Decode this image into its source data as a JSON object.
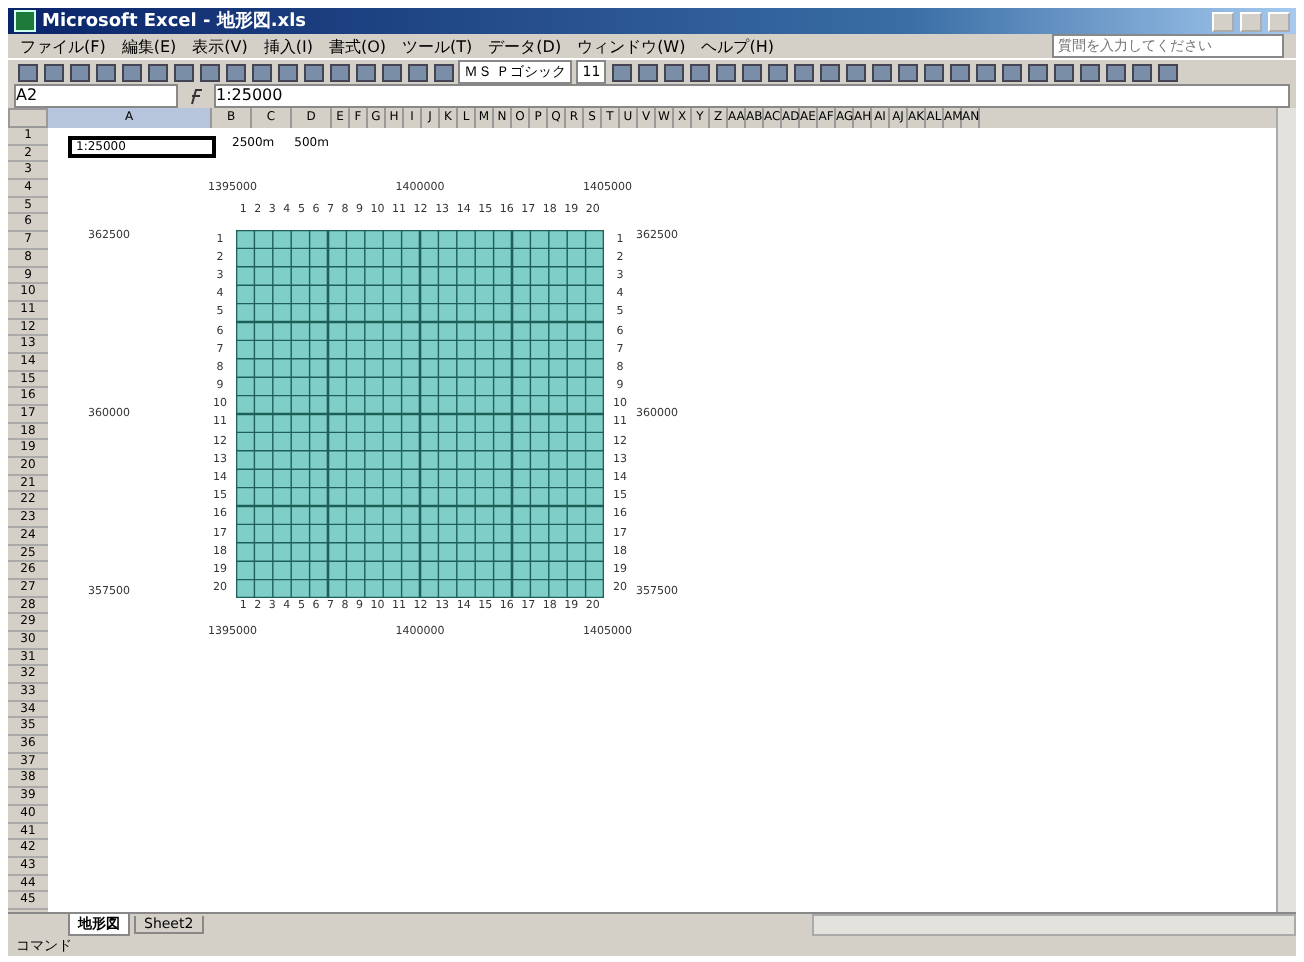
{
  "window": {
    "title": "Microsoft Excel - 地形図.xls"
  },
  "menus": [
    "ファイル(F)",
    "編集(E)",
    "表示(V)",
    "挿入(I)",
    "書式(O)",
    "ツール(T)",
    "データ(D)",
    "ウィンドウ(W)",
    "ヘルプ(H)"
  ],
  "help_box": {
    "placeholder": "質問を入力してください"
  },
  "toolbar": {
    "font_name": "ＭＳ Ｐゴシック",
    "font_size": "11"
  },
  "formula_bar": {
    "name_box": "A2",
    "value": "1:25000"
  },
  "columns": [
    "A",
    "B",
    "C",
    "D",
    "E",
    "F",
    "G",
    "H",
    "I",
    "J",
    "K",
    "L",
    "M",
    "N",
    "O",
    "P",
    "Q",
    "R",
    "S",
    "T",
    "U",
    "V",
    "W",
    "X",
    "Y",
    "Z",
    "AA",
    "AB",
    "AC",
    "AD",
    "AE",
    "AF",
    "AG",
    "AH",
    "AI",
    "AJ",
    "AK",
    "AL",
    "AM",
    "AN"
  ],
  "rows": [
    "1",
    "2",
    "3",
    "4",
    "5",
    "6",
    "7",
    "8",
    "9",
    "10",
    "11",
    "12",
    "13",
    "14",
    "15",
    "16",
    "17",
    "18",
    "19",
    "20",
    "21",
    "22",
    "23",
    "24",
    "25",
    "26",
    "27",
    "28",
    "29",
    "30",
    "31",
    "32",
    "33",
    "34",
    "35",
    "36",
    "37",
    "38",
    "39",
    "40",
    "41",
    "42",
    "43",
    "44",
    "45"
  ],
  "top_cells": [
    {
      "text": "1:25000",
      "selected": true
    },
    {
      "text": "2500m",
      "selected": false
    },
    {
      "text": "500m",
      "selected": false
    }
  ],
  "map_grid": {
    "top_labels": [
      "1395000",
      "1400000",
      "1405000"
    ],
    "bottom_labels": [
      "1395000",
      "1400000",
      "1405000"
    ],
    "left_labels": [
      "362500",
      "360000",
      "357500"
    ],
    "right_labels": [
      "362500",
      "360000",
      "357500"
    ],
    "top_column_numbers": [
      "1",
      "2",
      "3",
      "4",
      "5",
      "6",
      "7",
      "8",
      "9",
      "10",
      "11",
      "12",
      "13",
      "14",
      "15",
      "16",
      "17",
      "18",
      "19",
      "20"
    ],
    "left_row_numbers": [
      "1",
      "2",
      "3",
      "4",
      "5",
      "6",
      "7",
      "8",
      "9",
      "10",
      "11",
      "12",
      "13",
      "14",
      "15",
      "16",
      "17",
      "18",
      "19",
      "20"
    ],
    "right_row_numbers": [
      "1",
      "2",
      "3",
      "4",
      "5",
      "6",
      "7",
      "8",
      "9",
      "10",
      "11",
      "12",
      "13",
      "14",
      "15",
      "16",
      "17",
      "18",
      "19",
      "20"
    ],
    "bottom_column_numbers": [
      "1",
      "2",
      "3",
      "4",
      "5",
      "6",
      "7",
      "8",
      "9",
      "10",
      "11",
      "12",
      "13",
      "14",
      "15",
      "16",
      "17",
      "18",
      "19",
      "20"
    ]
  },
  "sheet_tabs": [
    {
      "label": "地形図",
      "selected": true
    },
    {
      "label": "Sheet2",
      "selected": false
    }
  ],
  "status_bar": "コマンド"
}
